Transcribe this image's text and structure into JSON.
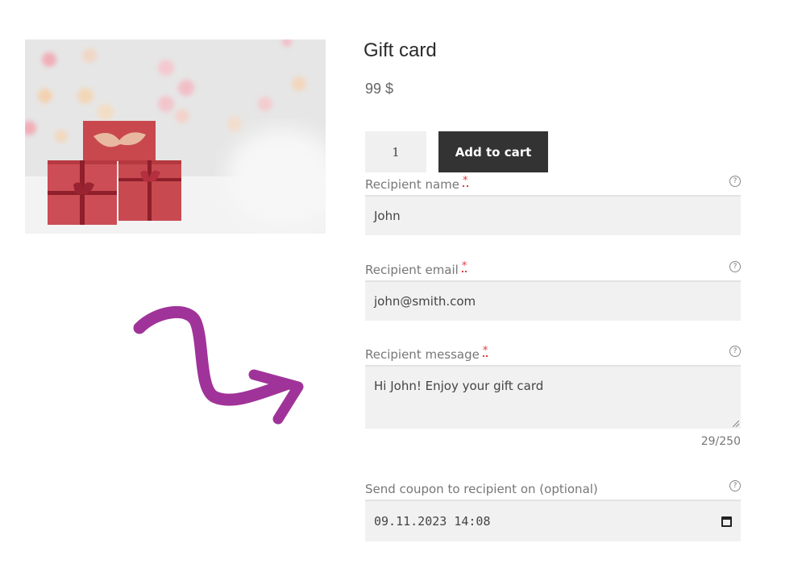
{
  "product": {
    "title": "Gift card",
    "price": "99 $",
    "image_alt": "Red gift boxes with ribbons on a snowy, bokeh background"
  },
  "cart": {
    "quantity": "1",
    "add_to_cart_label": "Add to cart"
  },
  "form": {
    "recipient_name": {
      "label": "Recipient name",
      "required_mark": "*",
      "value": "John",
      "help_icon": "question-circle-icon"
    },
    "recipient_email": {
      "label": "Recipient email",
      "required_mark": "*",
      "value": "john@smith.com",
      "help_icon": "question-circle-icon"
    },
    "recipient_message": {
      "label": "Recipient message",
      "required_mark": "*",
      "value": "Hi John! Enjoy your gift card",
      "counter": "29/250",
      "help_icon": "question-circle-icon"
    },
    "send_date": {
      "label": "Send coupon to recipient on (optional)",
      "value": "09.11.2023 14:08",
      "help_icon": "question-circle-icon",
      "picker_icon": "calendar-icon"
    }
  },
  "decoration": {
    "arrow_icon": "curved-arrow-icon",
    "arrow_color": "#a03399"
  },
  "help_glyph": "?"
}
